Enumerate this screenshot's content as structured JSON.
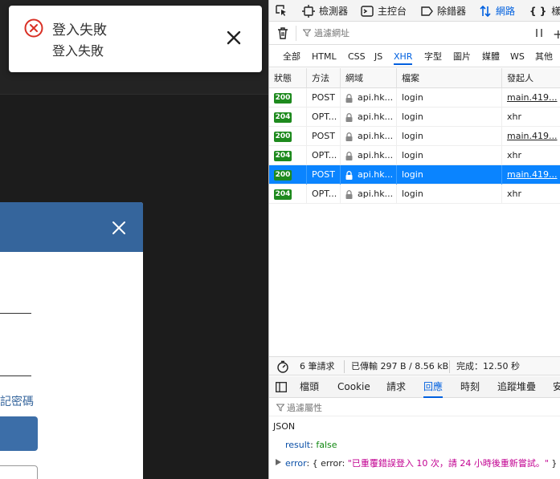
{
  "toast": {
    "title": "登入失敗",
    "message": "登入失敗"
  },
  "modal": {
    "forgot_label": "記密碼"
  },
  "devtools": {
    "tabs": [
      {
        "label": "檢測器",
        "icon": "inspector-icon"
      },
      {
        "label": "主控台",
        "icon": "console-icon"
      },
      {
        "label": "除錯器",
        "icon": "debugger-icon"
      },
      {
        "label": "網路",
        "icon": "network-icon",
        "active": true
      },
      {
        "label": "樣",
        "icon": "style-editor-icon"
      }
    ],
    "filter_placeholder": "過濾網址",
    "types": [
      "全部",
      "HTML",
      "CSS",
      "JS",
      "XHR",
      "字型",
      "圖片",
      "媒體",
      "WS",
      "其他"
    ],
    "active_type": "XHR",
    "columns": [
      "狀態",
      "方法",
      "網域",
      "檔案",
      "發起人"
    ],
    "rows": [
      {
        "status": "200",
        "method": "POST",
        "domain": "api.hk...",
        "file": "login",
        "initiator": "main.419...",
        "initiator_link": true
      },
      {
        "status": "204",
        "method": "OPT...",
        "domain": "api.hk...",
        "file": "login",
        "initiator": "xhr",
        "initiator_link": false
      },
      {
        "status": "200",
        "method": "POST",
        "domain": "api.hk...",
        "file": "login",
        "initiator": "main.419...",
        "initiator_link": true
      },
      {
        "status": "204",
        "method": "OPT...",
        "domain": "api.hk...",
        "file": "login",
        "initiator": "xhr",
        "initiator_link": false
      },
      {
        "status": "200",
        "method": "POST",
        "domain": "api.hk...",
        "file": "login",
        "initiator": "main.419...",
        "initiator_link": true,
        "selected": true
      },
      {
        "status": "204",
        "method": "OPT...",
        "domain": "api.hk...",
        "file": "login",
        "initiator": "xhr",
        "initiator_link": false
      }
    ],
    "summary": {
      "requests": "6 筆請求",
      "transferred": "已傳輸 297 B / 8.56 kB",
      "finished": "完成：12.50 秒"
    },
    "detail_tabs": [
      "檔頭",
      "Cookie",
      "請求",
      "回應",
      "時刻",
      "追蹤堆疊",
      "安"
    ],
    "active_detail_tab": "回應",
    "prop_filter_placeholder": "過濾屬性",
    "response": {
      "format": "JSON",
      "result_key": "result",
      "result_value": "false",
      "error_key": "error",
      "error_inner_key": "error",
      "error_message": "\"已重覆錯誤登入 10 次，請 24 小時後重新嘗試。\""
    }
  },
  "colors": {
    "accent": "#0060df",
    "selected_row": "#0a84ff",
    "status_ok": "#1e8a1e",
    "modal_header": "#35659c",
    "error_red": "#d93025"
  }
}
